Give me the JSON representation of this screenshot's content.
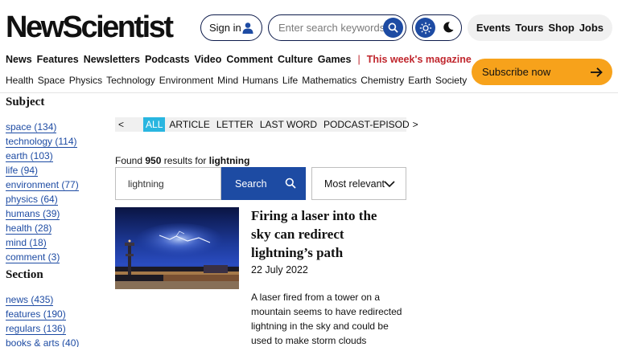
{
  "header": {
    "logo": "NewScientist",
    "sign_in": "Sign in",
    "search_placeholder": "Enter search keywords",
    "links": [
      "Events",
      "Tours",
      "Shop",
      "Jobs"
    ]
  },
  "nav_primary": [
    "News",
    "Features",
    "Newsletters",
    "Podcasts",
    "Video",
    "Comment",
    "Culture",
    "Games"
  ],
  "nav_magazine": "This week's magazine",
  "nav_topics": [
    "Health",
    "Space",
    "Physics",
    "Technology",
    "Environment",
    "Mind",
    "Humans",
    "Life",
    "Mathematics",
    "Chemistry",
    "Earth",
    "Society"
  ],
  "subscribe": "Subscribe now",
  "sidebar": {
    "subject_heading": "Subject",
    "subjects": [
      "space (134)",
      "technology (114)",
      "earth (103)",
      "life (94)",
      "environment (77)",
      "physics (64)",
      "humans (39)",
      "health (28)",
      "mind (18)",
      "comment (3)"
    ],
    "section_heading": "Section",
    "sections": [
      "news (435)",
      "features (190)",
      "regulars (136)",
      "books & arts (40)"
    ]
  },
  "filters": {
    "prev": "<",
    "tabs": [
      "ALL",
      "ARTICLE",
      "LETTER",
      "LAST WORD",
      "PODCAST-EPISOD"
    ],
    "next": ">",
    "active_tab": "ALL"
  },
  "results": {
    "found_prefix": "Found",
    "count": "950",
    "results_for": "results for",
    "query": "lightning",
    "search_button": "Search",
    "sort": "Most relevant",
    "items": [
      {
        "title": "Firing a laser into the sky can redirect lightning’s path",
        "date": "22 July 2022",
        "description": "A laser fired from a tower on a mountain seems to have redirected lightning in the sky and could be used to make storm clouds discharge"
      }
    ]
  },
  "colors": {
    "accent": "#1d4ba3",
    "subscribe": "#f7a21b",
    "magazine": "#c0262d",
    "active_tab": "#29b6e0"
  }
}
